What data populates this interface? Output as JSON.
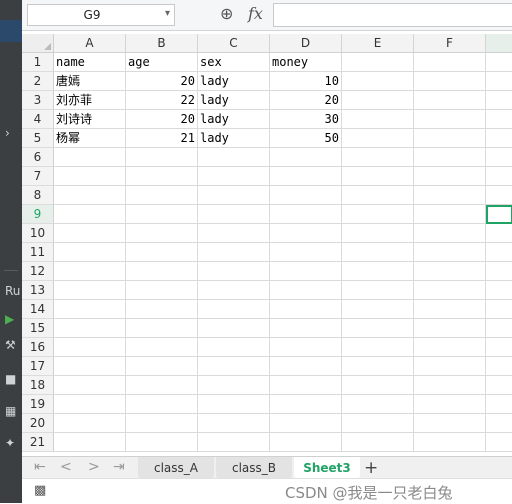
{
  "formula_bar": {
    "name_box": "G9",
    "dropdown_icon": "caret-down",
    "zoom_icon": "magnifier-zoom",
    "fx_label": "fx",
    "formula_value": ""
  },
  "columns": [
    "A",
    "B",
    "C",
    "D",
    "E",
    "F"
  ],
  "rows": [
    "1",
    "2",
    "3",
    "4",
    "5",
    "6",
    "7",
    "8",
    "9",
    "10",
    "11",
    "12",
    "13",
    "14",
    "15",
    "16",
    "17",
    "18",
    "19",
    "20",
    "21"
  ],
  "cells": [
    [
      "name",
      "age",
      "sex",
      "money"
    ],
    [
      "唐嫣",
      "20",
      "lady",
      "10"
    ],
    [
      "刘亦菲",
      "22",
      "lady",
      "20"
    ],
    [
      "刘诗诗",
      "20",
      "lady",
      "30"
    ],
    [
      "杨幂",
      "21",
      "lady",
      "50"
    ]
  ],
  "selected_cell": "G9",
  "sheet_tabs": [
    "class_A",
    "class_B",
    "Sheet3"
  ],
  "active_tab": "Sheet3",
  "add_tab_label": "+",
  "nav_buttons": [
    "|<",
    "<",
    ">",
    ">|"
  ],
  "left_panel": {
    "label": "Ru"
  },
  "watermark": "CSDN @我是一只老白兔",
  "colors": {
    "accent": "#21a366",
    "header_bg": "#f3f3f3",
    "grid_line": "#dadada"
  }
}
